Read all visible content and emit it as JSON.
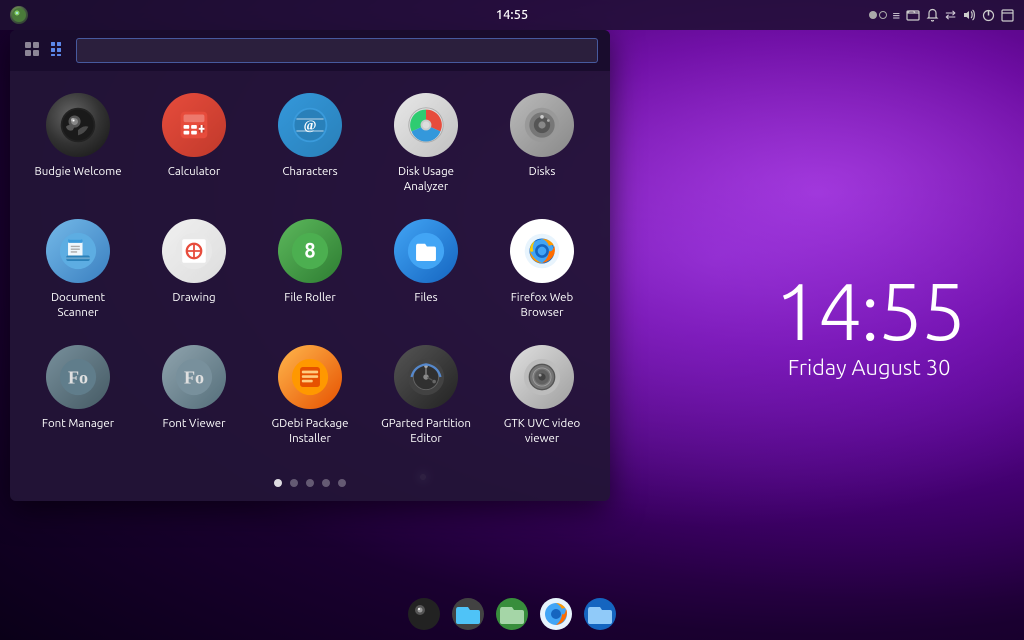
{
  "panel": {
    "time": "14:55",
    "indicator_icons": [
      "●○",
      "≡",
      "🖫",
      "🔔",
      "⇄",
      "🔊",
      "⏻",
      "⬜"
    ]
  },
  "clock": {
    "time": "14:55",
    "date": "Friday August 30"
  },
  "menu": {
    "search_placeholder": "",
    "apps": [
      {
        "id": "budgie-welcome",
        "label": "Budgie Welcome",
        "icon_type": "budgie-welcome"
      },
      {
        "id": "calculator",
        "label": "Calculator",
        "icon_type": "calculator"
      },
      {
        "id": "characters",
        "label": "Characters",
        "icon_type": "characters"
      },
      {
        "id": "disk-usage-analyzer",
        "label": "Disk Usage Analyzer",
        "icon_type": "disk-usage"
      },
      {
        "id": "disks",
        "label": "Disks",
        "icon_type": "disks"
      },
      {
        "id": "document-scanner",
        "label": "Document Scanner",
        "icon_type": "doc-scanner"
      },
      {
        "id": "drawing",
        "label": "Drawing",
        "icon_type": "drawing"
      },
      {
        "id": "file-roller",
        "label": "File Roller",
        "icon_type": "file-roller"
      },
      {
        "id": "files",
        "label": "Files",
        "icon_type": "files"
      },
      {
        "id": "firefox",
        "label": "Firefox Web Browser",
        "icon_type": "firefox"
      },
      {
        "id": "font-manager",
        "label": "Font Manager",
        "icon_type": "font-manager"
      },
      {
        "id": "font-viewer",
        "label": "Font Viewer",
        "icon_type": "font-viewer"
      },
      {
        "id": "gdebi",
        "label": "GDebi Package Installer",
        "icon_type": "gdebi"
      },
      {
        "id": "gparted",
        "label": "GParted Partition Editor",
        "icon_type": "gparted"
      },
      {
        "id": "gtk-uvc",
        "label": "GTK UVC video viewer",
        "icon_type": "gtk-uvc"
      }
    ],
    "page_dots": [
      {
        "active": true
      },
      {
        "active": false
      },
      {
        "active": false
      },
      {
        "active": false
      },
      {
        "active": false
      }
    ]
  },
  "taskbar": {
    "items": [
      "budgie-welcome",
      "files",
      "nautilus",
      "firefox",
      "nemo"
    ]
  }
}
